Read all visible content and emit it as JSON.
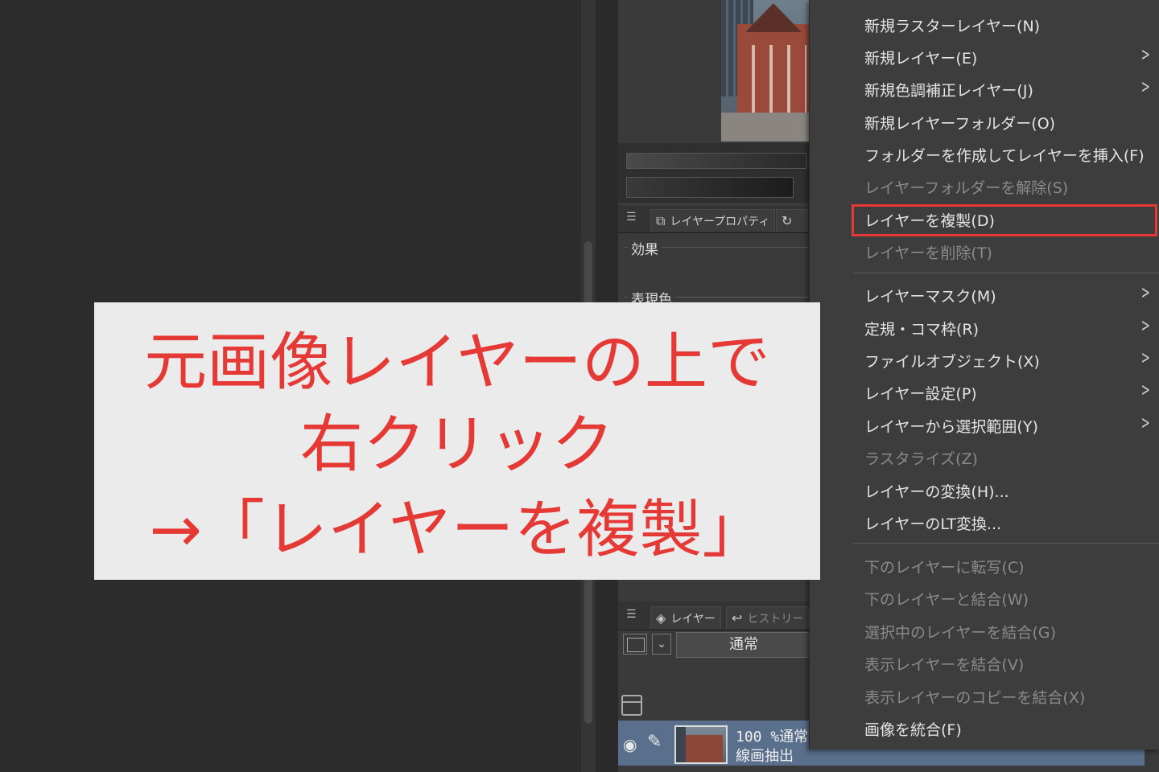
{
  "panel": {
    "property_tab_label": "レイヤープロパティ",
    "effect_label": "効果",
    "expression_color_label": "表現色",
    "layer_tab_label": "レイヤー",
    "history_tab_label": "ヒストリー",
    "blend_mode": "通常",
    "layer": {
      "opacity": "100 %通常",
      "name": "線画抽出"
    }
  },
  "context_menu": {
    "items": [
      {
        "label": "新規ラスターレイヤー(N)",
        "enabled": true,
        "submenu": false
      },
      {
        "label": "新規レイヤー(E)",
        "enabled": true,
        "submenu": true
      },
      {
        "label": "新規色調補正レイヤー(J)",
        "enabled": true,
        "submenu": true
      },
      {
        "label": "新規レイヤーフォルダー(O)",
        "enabled": true,
        "submenu": false
      },
      {
        "label": "フォルダーを作成してレイヤーを挿入(F)",
        "enabled": true,
        "submenu": false
      },
      {
        "label": "レイヤーフォルダーを解除(S)",
        "enabled": false,
        "submenu": false
      },
      {
        "label": "レイヤーを複製(D)",
        "enabled": true,
        "submenu": false,
        "highlighted": true
      },
      {
        "label": "レイヤーを削除(T)",
        "enabled": false,
        "submenu": false
      },
      {
        "label": "レイヤーマスク(M)",
        "enabled": true,
        "submenu": true
      },
      {
        "label": "定規・コマ枠(R)",
        "enabled": true,
        "submenu": true
      },
      {
        "label": "ファイルオブジェクト(X)",
        "enabled": true,
        "submenu": true
      },
      {
        "label": "レイヤー設定(P)",
        "enabled": true,
        "submenu": true
      },
      {
        "label": "レイヤーから選択範囲(Y)",
        "enabled": true,
        "submenu": true
      },
      {
        "label": "ラスタライズ(Z)",
        "enabled": false,
        "submenu": false
      },
      {
        "label": "レイヤーの変換(H)...",
        "enabled": true,
        "submenu": false
      },
      {
        "label": "レイヤーのLT変換...",
        "enabled": true,
        "submenu": false
      },
      {
        "label": "下のレイヤーに転写(C)",
        "enabled": false,
        "submenu": false
      },
      {
        "label": "下のレイヤーと結合(W)",
        "enabled": false,
        "submenu": false
      },
      {
        "label": "選択中のレイヤーを結合(G)",
        "enabled": false,
        "submenu": false
      },
      {
        "label": "表示レイヤーを結合(V)",
        "enabled": false,
        "submenu": false
      },
      {
        "label": "表示レイヤーのコピーを結合(X)",
        "enabled": false,
        "submenu": false
      },
      {
        "label": "画像を統合(F)",
        "enabled": true,
        "submenu": false
      }
    ]
  },
  "annotation": {
    "line1": "元画像レイヤーの上で",
    "line2": "右クリック",
    "line3": "→「レイヤーを複製」",
    "color": "#e53935"
  },
  "colors": {
    "highlight_border": "#e53935",
    "menu_bg": "#3d3d3d",
    "selected_layer_bg": "#5a6f8c"
  }
}
